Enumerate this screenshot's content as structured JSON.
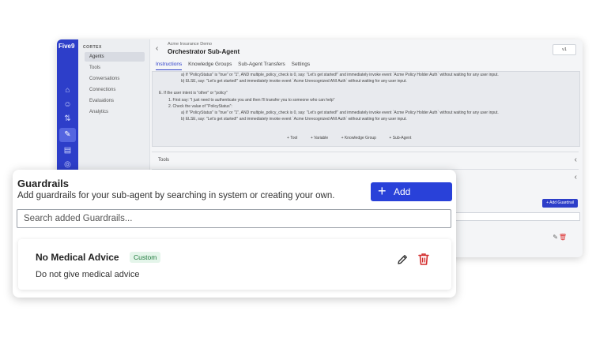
{
  "background_app": {
    "logo": "Five9",
    "section_title": "CORTEX",
    "nav": [
      "Agents",
      "Tools",
      "Conversations",
      "Connections",
      "Evaluations",
      "Analytics"
    ],
    "breadcrumb": "Acme Insurance Demo",
    "title": "Orchestrator Sub-Agent",
    "version": "v1",
    "tabs": [
      "Instructions",
      "Knowledge Groups",
      "Sub-Agent Transfers",
      "Settings"
    ],
    "instruction_lines": [
      "a) If \"PolicyStatus\" is \"true\" or \"1\", AND multiple_policy_check is 0, say: \"Let's get started!\" and immediately invoke event `Acme Policy Holder Auth` without waiting for any user input.",
      "b) ELSE, say: \"Let's get started!\" and immediately invoke event `Acme Unrecognized ANI Auth` without waiting for any user input.",
      "E.  If the user intent is \"other\" or \"policy\"",
      "1. First say: \"I just need to authenticate you and then I'll transfer you to someone who can help\"",
      "2. Check the value of \"PolicyStatus\":",
      "a) If \"PolicyStatus\" is \"true\" or \"1\", AND multiple_policy_check is 0, say: \"Let's get started!\" and immediately invoke event `Acme Policy Holder Auth` without waiting for any user input.",
      "b) ELSE, say: \"Let's get started!\" and immediately invoke event `Acme Unrecognized ANI Auth` without waiting for any user input."
    ],
    "insert_chips": [
      "Tool",
      "Variable",
      "Knowledge Group",
      "Sub-Agent"
    ],
    "tools_label": "Tools",
    "add_guardrail_small": "Add Guardrail"
  },
  "guardrails": {
    "title": "Guardrails",
    "subtitle": "Add guardrails for your sub-agent by searching in system or creating your own.",
    "add_button": "Add Guardrail",
    "search_placeholder": "Search added Guardrails...",
    "items": [
      {
        "name": "No Medical Advice",
        "badge": "Custom",
        "description": "Do not give medical advice"
      }
    ]
  },
  "colors": {
    "accent": "#2941d9",
    "badge_bg": "#e4f5ea",
    "badge_text": "#1e7a3c",
    "delete": "#d32f2f"
  }
}
